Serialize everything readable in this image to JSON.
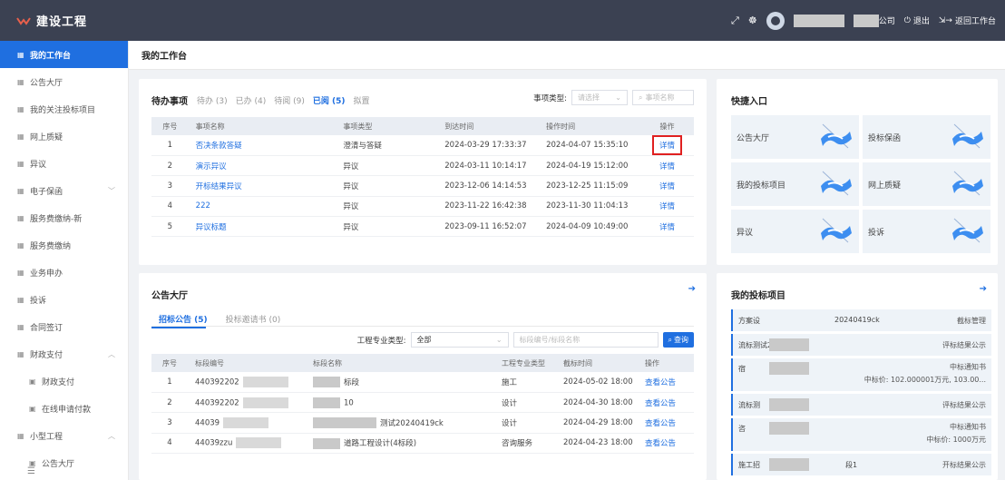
{
  "header": {
    "app_title": "建设工程",
    "user_suffix": "公司",
    "logout_label": "退出",
    "back_label": "返回工作台"
  },
  "sidebar": {
    "items": [
      {
        "label": "我的工作台",
        "active": true
      },
      {
        "label": "公告大厅"
      },
      {
        "label": "我的关注投标项目"
      },
      {
        "label": "网上质疑"
      },
      {
        "label": "异议"
      },
      {
        "label": "电子保函",
        "expand": "down"
      },
      {
        "label": "服务费缴纳-新"
      },
      {
        "label": "服务费缴纳"
      },
      {
        "label": "业务申办"
      },
      {
        "label": "投诉"
      },
      {
        "label": "合同签订"
      },
      {
        "label": "财政支付",
        "expand": "up"
      },
      {
        "label": "财政支付",
        "sub": true
      },
      {
        "label": "在线申请付款",
        "sub": true
      },
      {
        "label": "小型工程",
        "expand": "up"
      },
      {
        "label": "公告大厅",
        "sub": true
      }
    ]
  },
  "page_title": "我的工作台",
  "todo": {
    "title": "待办事项",
    "tabs": [
      "待办 (3)",
      "已办 (4)",
      "待阅 (9)",
      "已阅 (5)",
      "拟置"
    ],
    "active_tab": 3,
    "filter_label": "事项类型:",
    "filter_placeholder": "请选择",
    "search_placeholder": "事项名称",
    "columns": [
      "序号",
      "事项名称",
      "事项类型",
      "到达时间",
      "操作时间",
      "操作"
    ],
    "rows": [
      {
        "no": "1",
        "name": "否决条款答疑",
        "type": "澄清与答疑",
        "arrive": "2024-03-29 17:33:37",
        "op_time": "2024-04-07 15:35:10",
        "action": "详情"
      },
      {
        "no": "2",
        "name": "演示异议",
        "type": "异议",
        "arrive": "2024-03-11 10:14:17",
        "op_time": "2024-04-19 15:12:00",
        "action": "详情"
      },
      {
        "no": "3",
        "name": "开标结果异议",
        "type": "异议",
        "arrive": "2023-12-06 14:14:53",
        "op_time": "2023-12-25 11:15:09",
        "action": "详情"
      },
      {
        "no": "4",
        "name": "222",
        "type": "异议",
        "arrive": "2023-11-22 16:42:38",
        "op_time": "2023-11-30 11:04:13",
        "action": "详情"
      },
      {
        "no": "5",
        "name": "异议标题",
        "type": "异议",
        "arrive": "2023-09-11 16:52:07",
        "op_time": "2024-04-09 10:49:00",
        "action": "详情"
      }
    ]
  },
  "notice": {
    "title": "公告大厅",
    "tabs": [
      "招标公告 (5)",
      "投标邀请书 (0)"
    ],
    "filter_label": "工程专业类型:",
    "filter_value": "全部",
    "search_placeholder": "标段编号/标段名称",
    "search_button": "查询",
    "columns": [
      "序号",
      "标段编号",
      "标段名称",
      "工程专业类型",
      "截标时间",
      "操作"
    ],
    "rows": [
      {
        "no": "1",
        "code": "440392202",
        "name": "标段",
        "type": "施工",
        "deadline": "2024-05-02 18:00",
        "action": "查看公告"
      },
      {
        "no": "2",
        "code": "440392202",
        "name": "10",
        "type": "设计",
        "deadline": "2024-04-30 18:00",
        "action": "查看公告"
      },
      {
        "no": "3",
        "code": "44039",
        "name": "测试20240419ck",
        "type": "设计",
        "deadline": "2024-04-29 18:00",
        "action": "查看公告"
      },
      {
        "no": "4",
        "code": "44039zzu",
        "name": "道路工程设计(4标段)",
        "type": "咨询服务",
        "deadline": "2024-04-23 18:00",
        "action": "查看公告"
      }
    ]
  },
  "quick": {
    "title": "快捷入口",
    "items": [
      "公告大厅",
      "投标保函",
      "我的投标项目",
      "网上质疑",
      "异议",
      "投诉"
    ]
  },
  "bids": {
    "title": "我的投标项目",
    "items": [
      {
        "left": "方案设",
        "mid": "20240419ck",
        "right": "截标管理"
      },
      {
        "left": "流标测试202",
        "mid": "",
        "right": "评标结果公示"
      },
      {
        "left": "宿",
        "mid": "",
        "right": "中标通知书",
        "right2": "中标价: 102.000001万元, 103.00..."
      },
      {
        "left": "流标测",
        "mid": "",
        "right": "评标结果公示"
      },
      {
        "left": "咨",
        "mid": "",
        "right": "中标通知书",
        "right2": "中标价: 1000万元"
      },
      {
        "left": "施工招",
        "mid": "段1",
        "right": "开标结果公示"
      }
    ]
  },
  "colors": {
    "accent": "#1f6fe0",
    "topbar": "#3b4152",
    "highlight": "#e02020"
  }
}
